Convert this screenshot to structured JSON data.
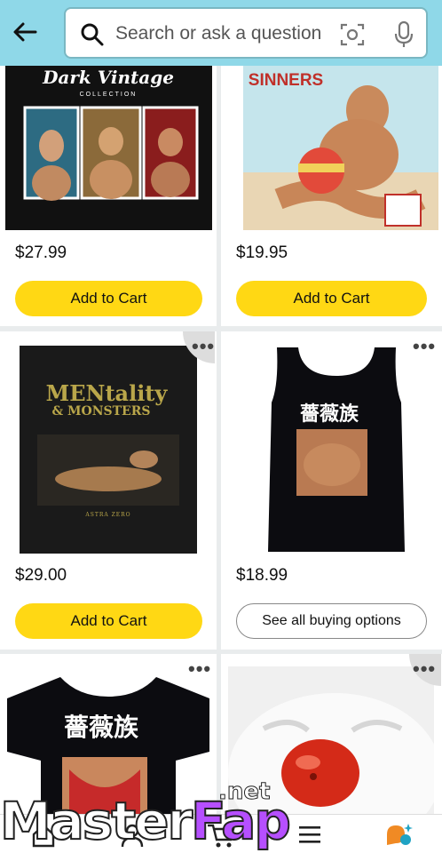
{
  "search": {
    "placeholder": "Search or ask a question"
  },
  "products": [
    {
      "price": "$27.99",
      "button": "Add to Cart",
      "image_text": [
        "Dark Vintage",
        "COLLECTION"
      ]
    },
    {
      "price": "$19.95",
      "button": "Add to Cart",
      "image_text": [
        "SINNERS"
      ]
    },
    {
      "price": "$29.00",
      "button": "Add to Cart",
      "image_text": [
        "MENtality",
        "& MONSTERS",
        "ASTRA ZERO"
      ]
    },
    {
      "price": "$18.99",
      "button": "See all buying options",
      "image_text": [
        "薔薇族"
      ]
    },
    {
      "image_text": [
        "薔薇族"
      ]
    },
    {
      "image_text": []
    }
  ],
  "more_options": "•••",
  "watermark": {
    "master": "Master",
    "fap": "Fap",
    "net": ".net"
  },
  "colors": {
    "header": "#8fd8e8",
    "add_to_cart": "#ffd814",
    "background": "#e9eced"
  }
}
